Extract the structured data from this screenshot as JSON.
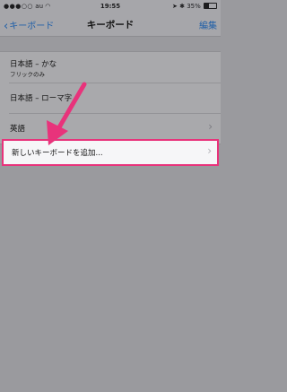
{
  "status_bar": {
    "carrier": "au",
    "time": "19:55",
    "battery": "35%",
    "battery_level": 0.35
  },
  "nav": {
    "back_label": "キーボード",
    "title": "キーボード",
    "edit_label": "編集"
  },
  "keyboards": [
    {
      "title": "日本語 – かな",
      "subtitle": "フリックのみ"
    },
    {
      "title": "日本語 – ローマ字"
    },
    {
      "title": "英語"
    }
  ],
  "add_keyboard_label": "新しいキーボードを追加...",
  "colors": {
    "accent": "#1f5fa8",
    "highlight_border": "#e8337b",
    "arrow": "#e8337b"
  },
  "icons": {
    "back": "chevron-left-icon",
    "row": "chevron-right-icon",
    "annotation": "pink-arrow-icon"
  }
}
